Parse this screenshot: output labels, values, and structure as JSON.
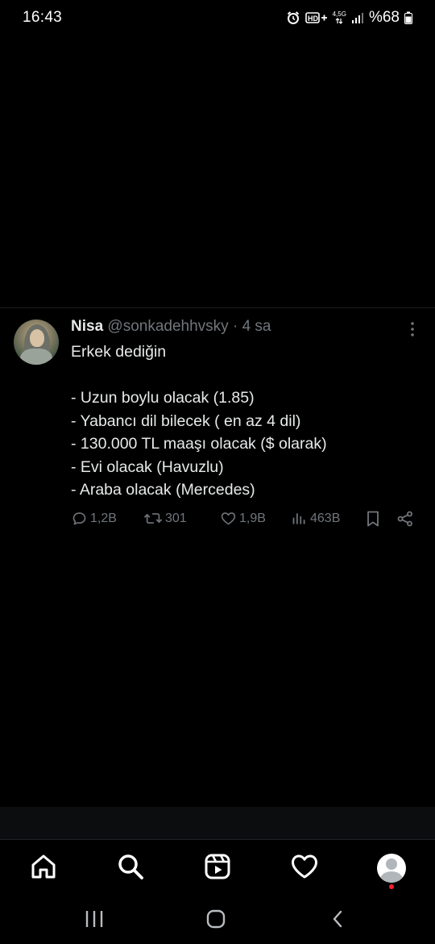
{
  "status_bar": {
    "time": "16:43",
    "network": "4,5G",
    "battery": "%68",
    "icons": [
      "alarm-icon",
      "hd-plus-icon",
      "signal-icon",
      "battery-icon"
    ]
  },
  "tweet": {
    "name": "Nisa",
    "handle": "@sonkadehhvsky",
    "separator": "·",
    "time": "4 sa",
    "lines": [
      "Erkek dediğin",
      "",
      "- Uzun boylu olacak (1.85)",
      "- Yabancı dil bilecek ( en az 4 dil)",
      "- 130.000 TL maaşı olacak ($ olarak)",
      "- Evi olacak (Havuzlu)",
      "- Araba olacak (Mercedes)"
    ],
    "stats": {
      "replies": "1,2B",
      "retweets": "301",
      "likes": "1,9B",
      "views": "463B"
    }
  },
  "bottom_nav": {
    "items": [
      "home-icon",
      "search-icon",
      "reels-icon",
      "heart-icon",
      "profile-avatar"
    ]
  },
  "colors": {
    "background": "#000000",
    "text": "#e7e9ea",
    "muted": "#71767b",
    "notification_dot": "#f4212e"
  }
}
